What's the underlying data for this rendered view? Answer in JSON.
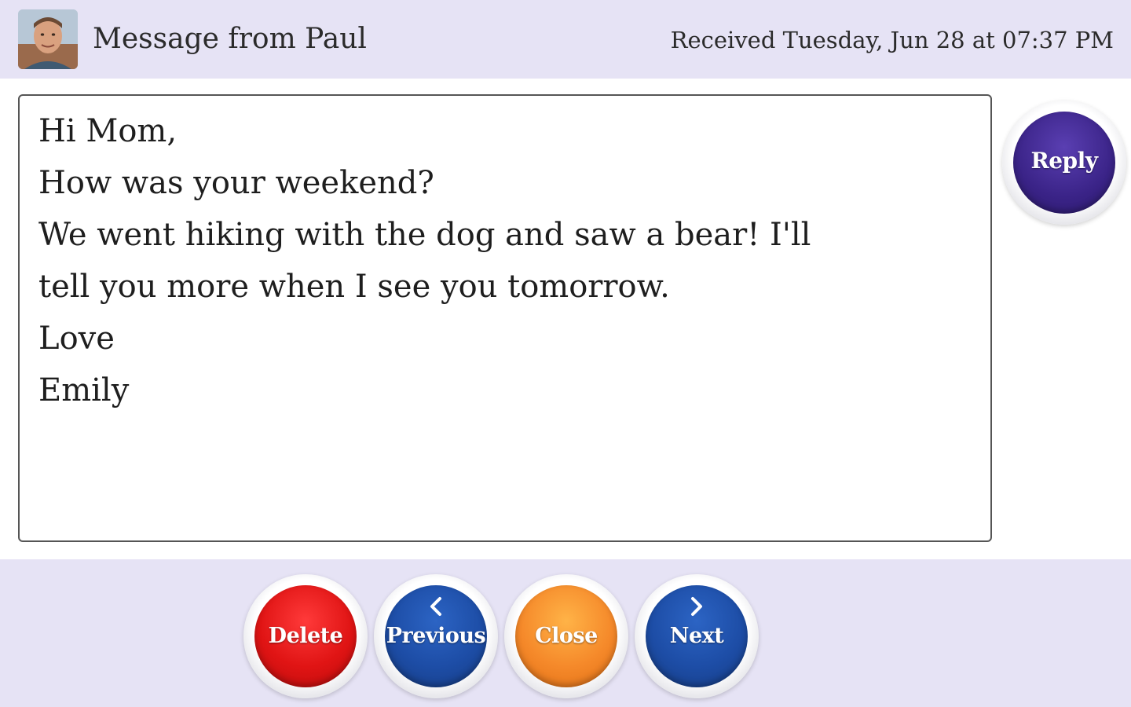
{
  "header": {
    "title": "Message from Paul",
    "received": "Received Tuesday, Jun 28 at 07:37 PM",
    "avatar": "avatar-photo"
  },
  "message": {
    "lines": [
      "Hi Mom,",
      "How was your weekend?",
      "We went hiking with the dog and saw a bear! I'll",
      "tell you more when I see you tomorrow.",
      "Love",
      "Emily"
    ]
  },
  "actions": {
    "reply": "Reply",
    "delete": "Delete",
    "previous": "Previous",
    "close": "Close",
    "next": "Next"
  },
  "icons": {
    "previous": "chevron-left-icon",
    "next": "chevron-right-icon"
  },
  "colors": {
    "header_bg": "#e6e3f5",
    "reply": "#3a2387",
    "delete": "#e01414",
    "previous": "#1d4da6",
    "close": "#f5892a",
    "next": "#1d4da6"
  }
}
